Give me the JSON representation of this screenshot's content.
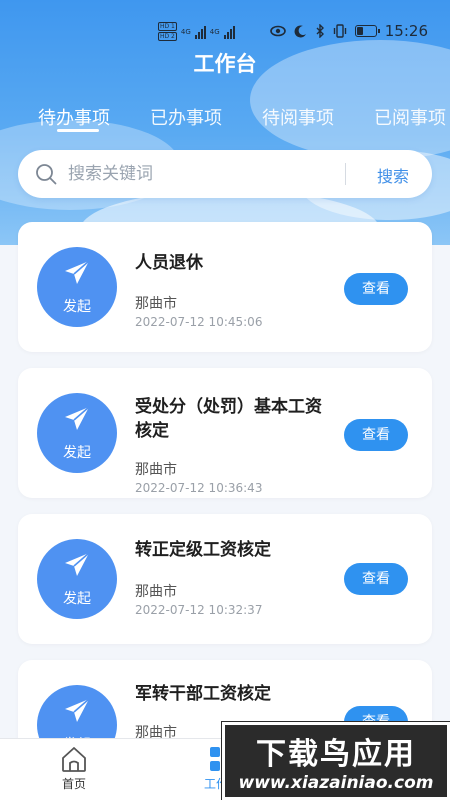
{
  "status_bar": {
    "hd1": "HD 1",
    "hd2": "HD 2",
    "net1": "4G",
    "net2": "4G",
    "time": "15:26"
  },
  "header": {
    "title": "工作台"
  },
  "tabs": [
    {
      "label": "待办事项",
      "active": true
    },
    {
      "label": "已办事项",
      "active": false
    },
    {
      "label": "待阅事项",
      "active": false
    },
    {
      "label": "已阅事项",
      "active": false
    }
  ],
  "search": {
    "placeholder": "搜索关键词",
    "button_label": "搜索"
  },
  "items": [
    {
      "badge": "发起",
      "title": "人员退休",
      "region": "那曲市",
      "time": "2022-07-12 10:45:06",
      "action": "查看"
    },
    {
      "badge": "发起",
      "title": "受处分（处罚）基本工资核定",
      "region": "那曲市",
      "time": "2022-07-12 10:36:43",
      "action": "查看"
    },
    {
      "badge": "发起",
      "title": "转正定级工资核定",
      "region": "那曲市",
      "time": "2022-07-12 10:32:37",
      "action": "查看"
    },
    {
      "badge": "发起",
      "title": "军转干部工资核定",
      "region": "那曲市",
      "time": "",
      "action": "查看"
    }
  ],
  "tab_bar": {
    "home_label": "首页",
    "work_label": "工作台"
  },
  "watermark": {
    "main": "下载鸟应用",
    "sub": "www.xiazainiao.com"
  },
  "colors": {
    "header_top": "#3f97ef",
    "accent": "#2f92f0",
    "avatar": "#4f92f2"
  }
}
